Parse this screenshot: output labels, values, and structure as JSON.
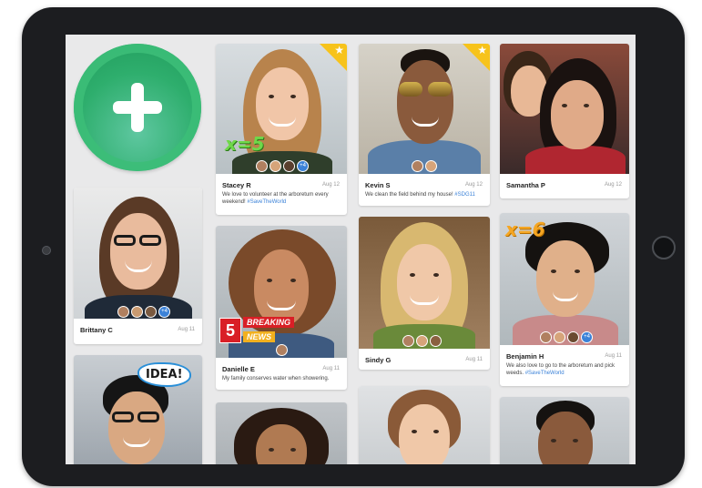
{
  "add_button": {
    "icon": "plus-icon"
  },
  "colors": {
    "accent_green": "#2eae6d",
    "link_blue": "#3b82d8",
    "star_yellow": "#f7c31b",
    "breaking_red": "#d91f26"
  },
  "cards": [
    {
      "name": "Stacey R",
      "date": "Aug 12",
      "post": "We love to volunteer at the arboretum every weekend! ",
      "tag": "#SaveTheWorld",
      "featured": true,
      "overlay": "x=5",
      "more_count": "+4"
    },
    {
      "name": "Kevin S",
      "date": "Aug 12",
      "post": "We clean the field behind my house! ",
      "tag": "#SDG11",
      "featured": true
    },
    {
      "name": "Samantha P",
      "date": "Aug 12",
      "post": ""
    },
    {
      "name": "Brittany C",
      "date": "Aug 11",
      "post": "",
      "more_count": "+4"
    },
    {
      "name": "Danielle E",
      "date": "Aug 11",
      "post": "My family conserves water when showering.",
      "breaking_number": "5",
      "breaking_line1": "BREAKING",
      "breaking_line2": "NEWS"
    },
    {
      "name": "Sindy G",
      "date": "Aug 11",
      "post": ""
    },
    {
      "name": "Benjamin H",
      "date": "Aug 11",
      "post": "We also love to go to the arboretum and pick weeds. ",
      "tag": "#SaveTheWorld",
      "overlay": "x=6",
      "more_count": "+4"
    },
    {
      "idea": "IDEA!"
    }
  ]
}
